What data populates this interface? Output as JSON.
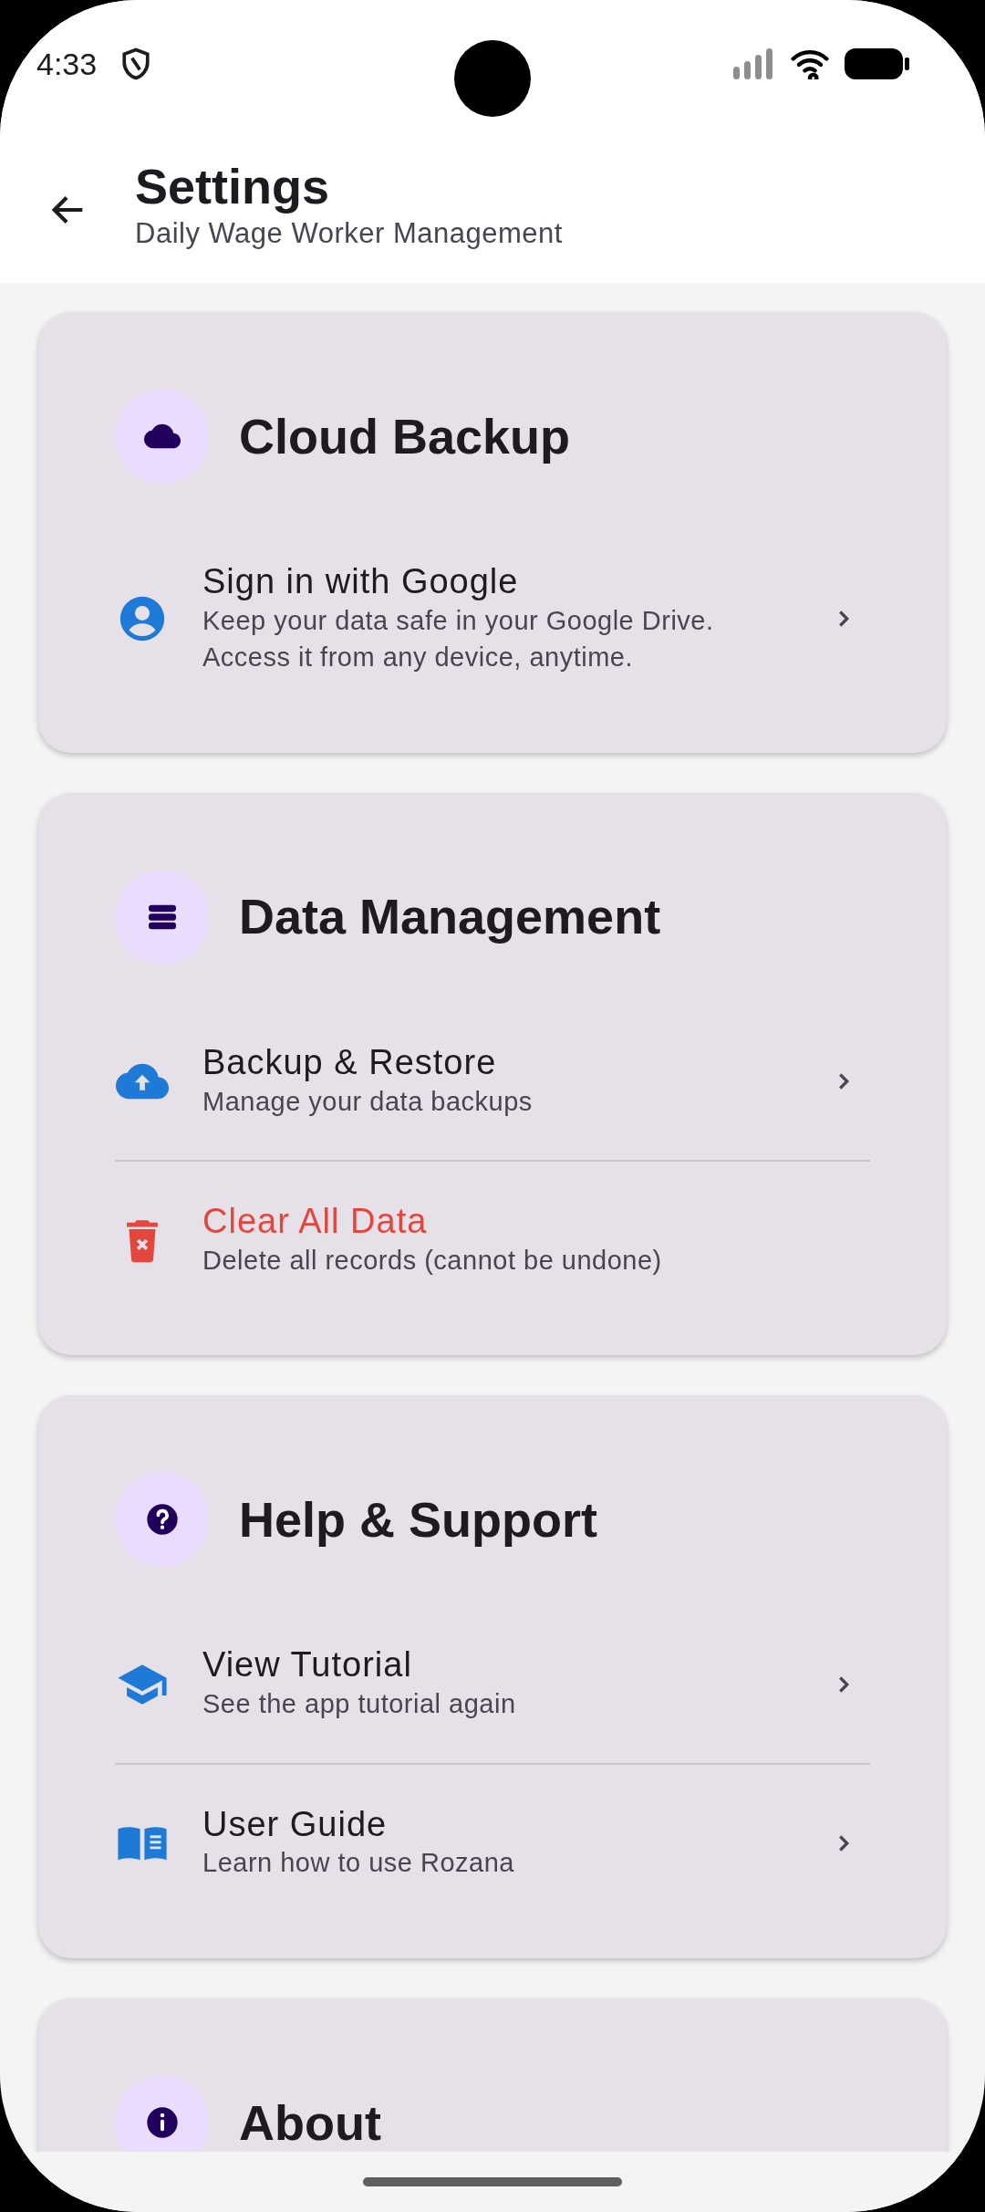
{
  "status_bar": {
    "time": "4:33"
  },
  "app_bar": {
    "title": "Settings",
    "subtitle": "Daily Wage Worker Management"
  },
  "sections": [
    {
      "title": "Cloud Backup",
      "items": [
        {
          "kind": "link",
          "title": "Sign in with Google",
          "subtitle": "Keep your data safe in your Google Drive.\nAccess it from any device, anytime."
        }
      ]
    },
    {
      "title": "Data Management",
      "items": [
        {
          "kind": "link",
          "title": "Backup & Restore",
          "subtitle": "Manage your data backups"
        },
        {
          "kind": "danger",
          "title": "Clear All Data",
          "subtitle": "Delete all records (cannot be undone)"
        }
      ]
    },
    {
      "title": "Help & Support",
      "items": [
        {
          "kind": "link",
          "title": "View Tutorial",
          "subtitle": "See the app tutorial again"
        },
        {
          "kind": "link",
          "title": "User Guide",
          "subtitle": "Learn how to use Rozana"
        }
      ]
    },
    {
      "title": "About"
    }
  ]
}
